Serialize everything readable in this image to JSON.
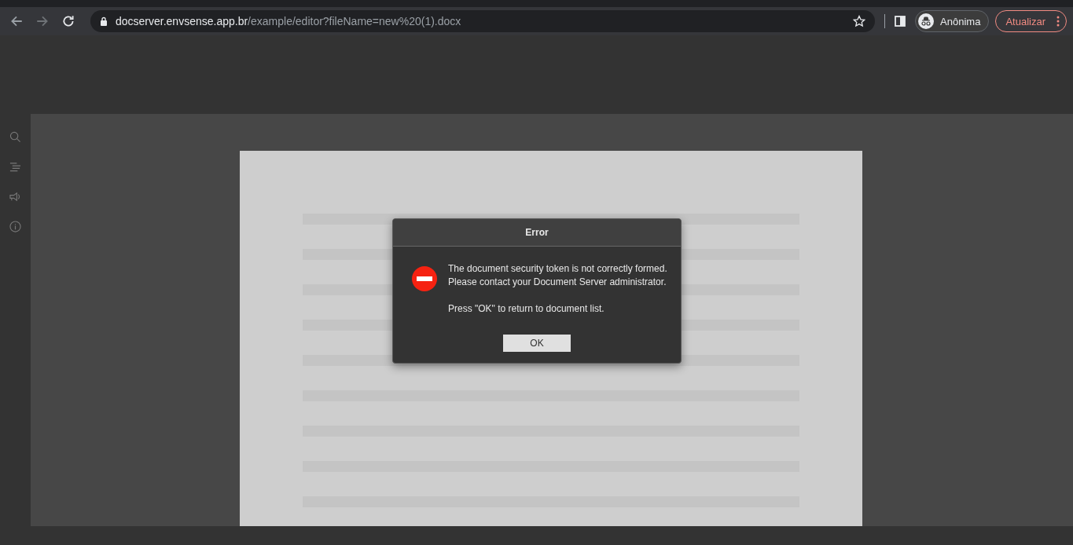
{
  "browser": {
    "address_bar": {
      "host": "docserver.envsense.app.br",
      "path": "/example/editor?fileName=new%20(1).docx"
    },
    "profile": {
      "label": "Anônima"
    },
    "update_button": {
      "label": "Atualizar"
    }
  },
  "dialog": {
    "title": "Error",
    "message_lines": [
      "The document security token is not correctly formed.",
      "Please contact your Document Server administrator."
    ],
    "hint": "Press \"OK\" to return to document list.",
    "button": "OK"
  }
}
